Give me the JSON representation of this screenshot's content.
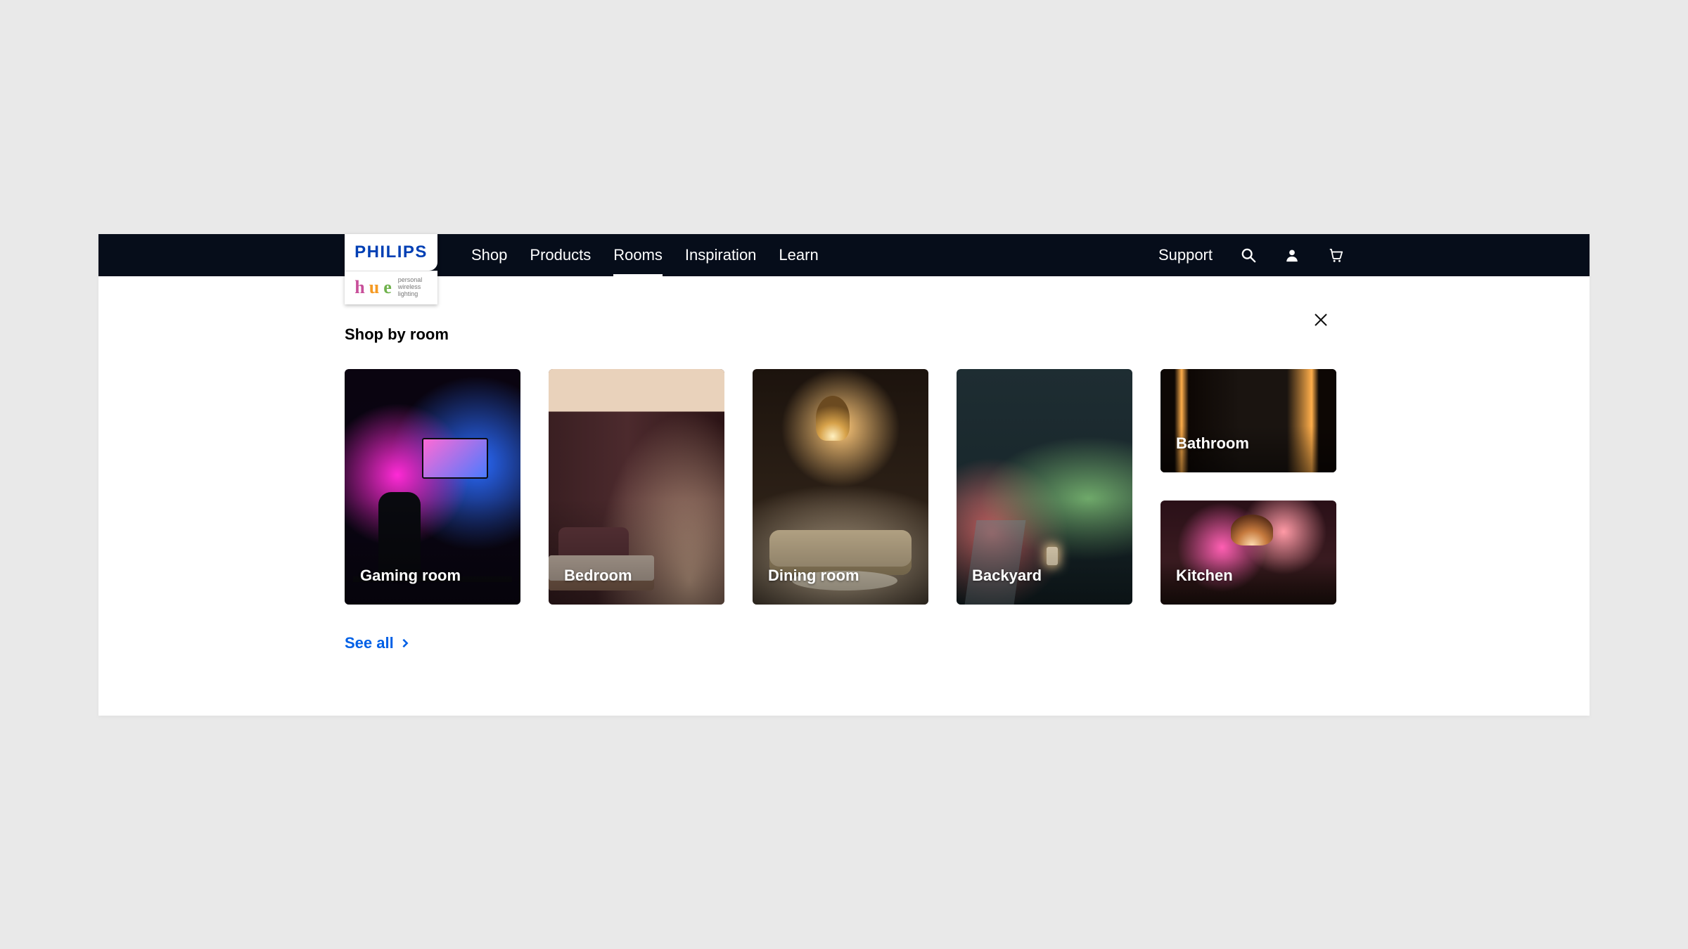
{
  "brand": {
    "name": "PHILIPS",
    "sub_h": "h",
    "sub_u": "u",
    "sub_e": "e",
    "sub_tag": "personal wireless lighting"
  },
  "nav": {
    "items": [
      {
        "label": "Shop",
        "active": false
      },
      {
        "label": "Products",
        "active": false
      },
      {
        "label": "Rooms",
        "active": true
      },
      {
        "label": "Inspiration",
        "active": false
      },
      {
        "label": "Learn",
        "active": false
      }
    ],
    "support": "Support"
  },
  "panel": {
    "title": "Shop by room",
    "see_all": "See all",
    "rooms": [
      {
        "label": "Gaming room"
      },
      {
        "label": "Bedroom"
      },
      {
        "label": "Dining room"
      },
      {
        "label": "Backyard"
      },
      {
        "label": "Bathroom"
      },
      {
        "label": "Kitchen"
      }
    ]
  },
  "colors": {
    "navbar_bg": "#060d1a",
    "link_accent": "#0060e6"
  }
}
